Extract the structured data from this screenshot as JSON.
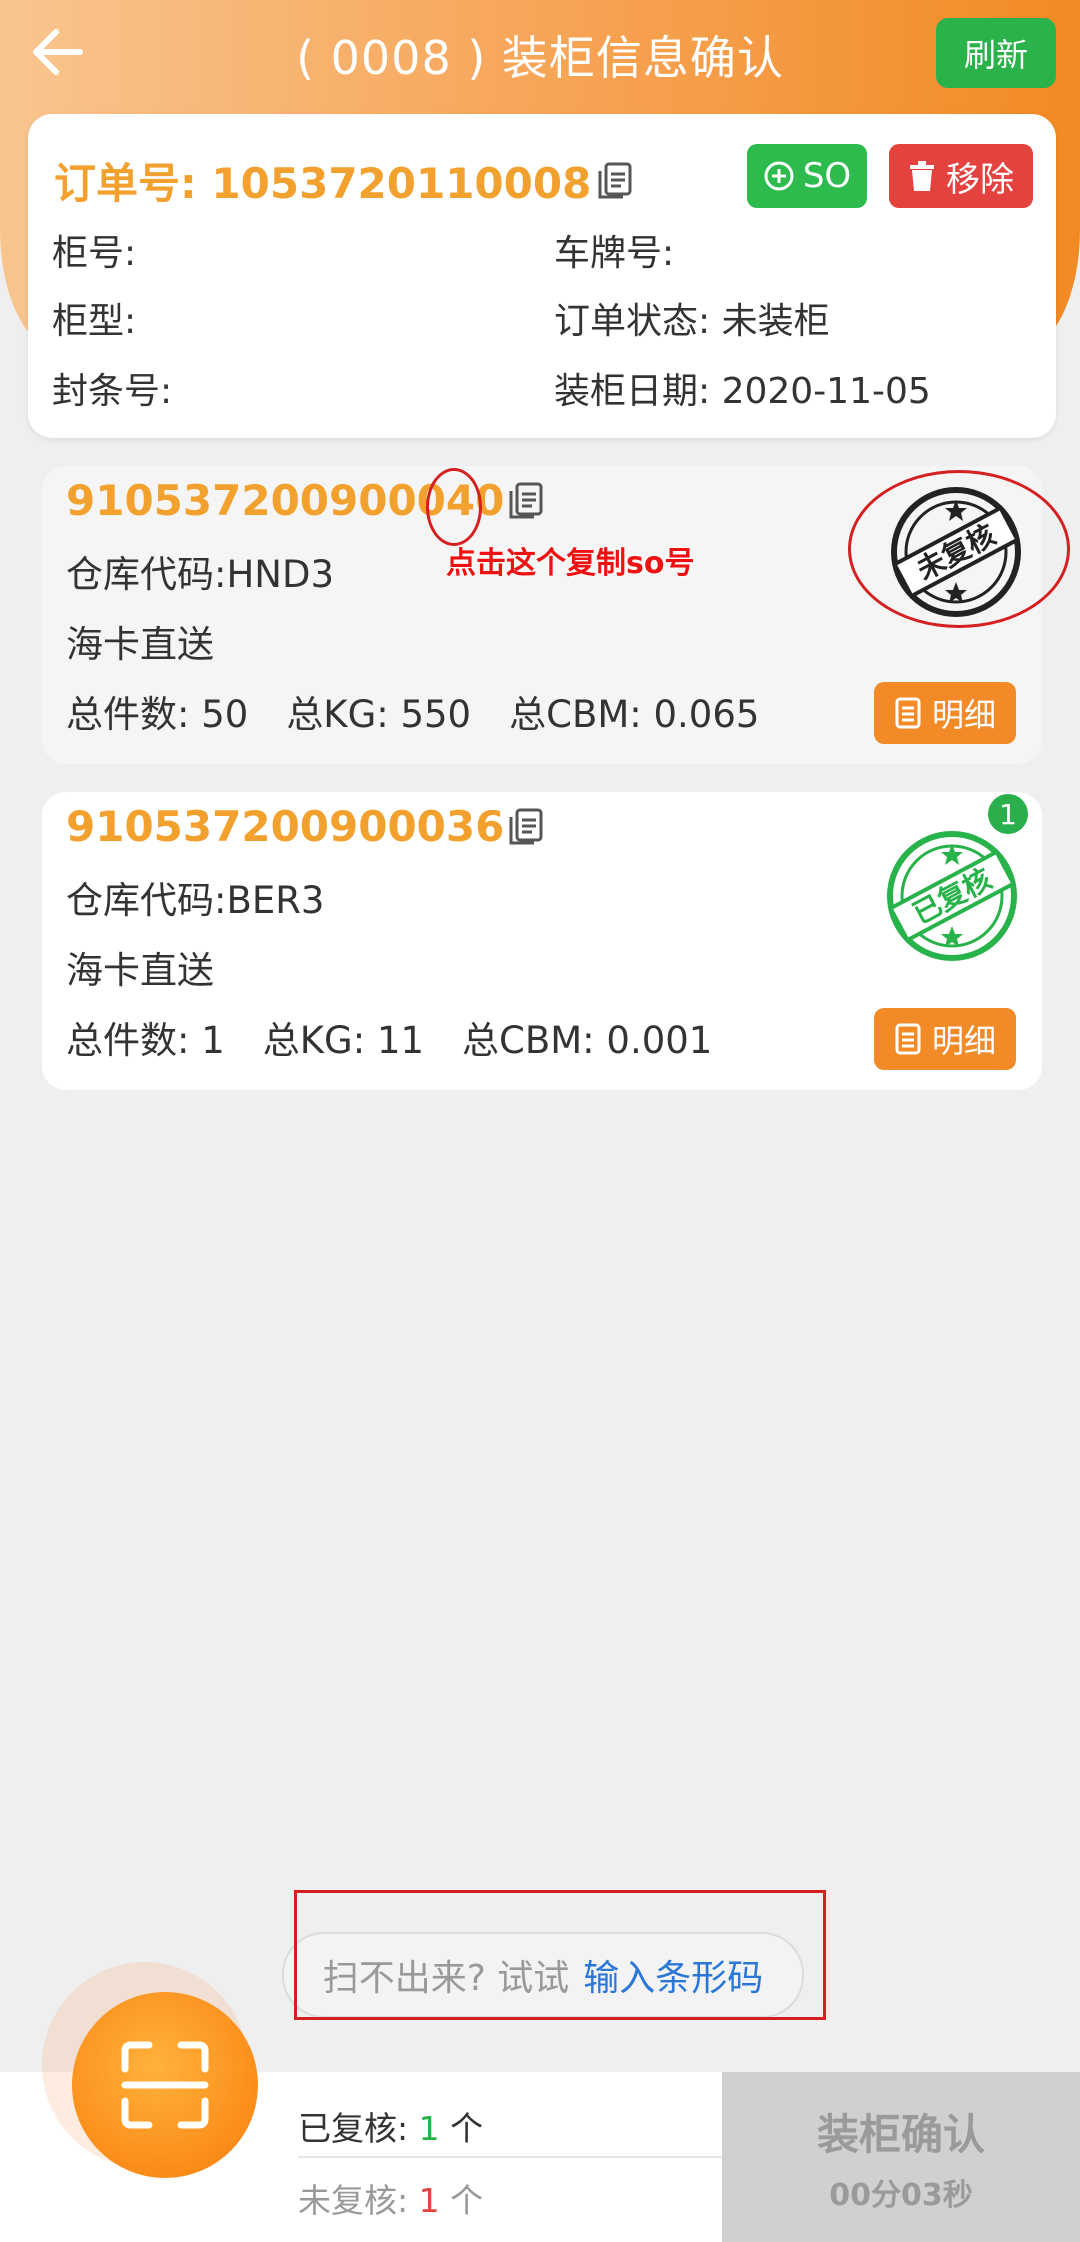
{
  "header": {
    "title": "( 0008 ) 装柜信息确认",
    "refresh_label": "刷新"
  },
  "order": {
    "order_no_label": "订单号: 1053720110008",
    "so_label": "SO",
    "remove_label": "移除",
    "cabinet_no": "柜号:",
    "plate_no": "车牌号:",
    "cabinet_type": "柜型:",
    "status": "订单状态: 未装柜",
    "seal_no": "封条号:",
    "load_date": "装柜日期: 2020-11-05"
  },
  "so_list": [
    {
      "so_no": "910537200900040",
      "warehouse": "仓库代码:HND3",
      "shipping": "海卡直送",
      "total_pieces": "总件数: 50",
      "total_kg": "总KG: 550",
      "total_cbm": "总CBM: 0.065",
      "detail_label": "明细",
      "stamp_text": "未复核",
      "stamp_color": "#222222"
    },
    {
      "so_no": "910537200900036",
      "warehouse": "仓库代码:BER3",
      "shipping": "海卡直送",
      "total_pieces": "总件数: 1",
      "total_kg": "总KG: 11",
      "total_cbm": "总CBM: 0.001",
      "detail_label": "明细",
      "stamp_text": "已复核",
      "stamp_color": "#27b24a",
      "badge": "1"
    }
  ],
  "annotation": {
    "text": "点击这个复制so号"
  },
  "manual_input": {
    "prefix": "扫不出来? 试试",
    "link": "输入条形码"
  },
  "footer": {
    "reviewed_label": "已复核:",
    "reviewed_count": "1",
    "unreviewed_label": "未复核:",
    "unreviewed_count": "1",
    "unit": "个",
    "confirm_label": "装柜确认",
    "timer": "00分03秒"
  },
  "colors": {
    "accent_orange": "#f3a12e",
    "green": "#2dbb4d",
    "red": "#e3423f",
    "link_blue": "#2b77d8"
  }
}
